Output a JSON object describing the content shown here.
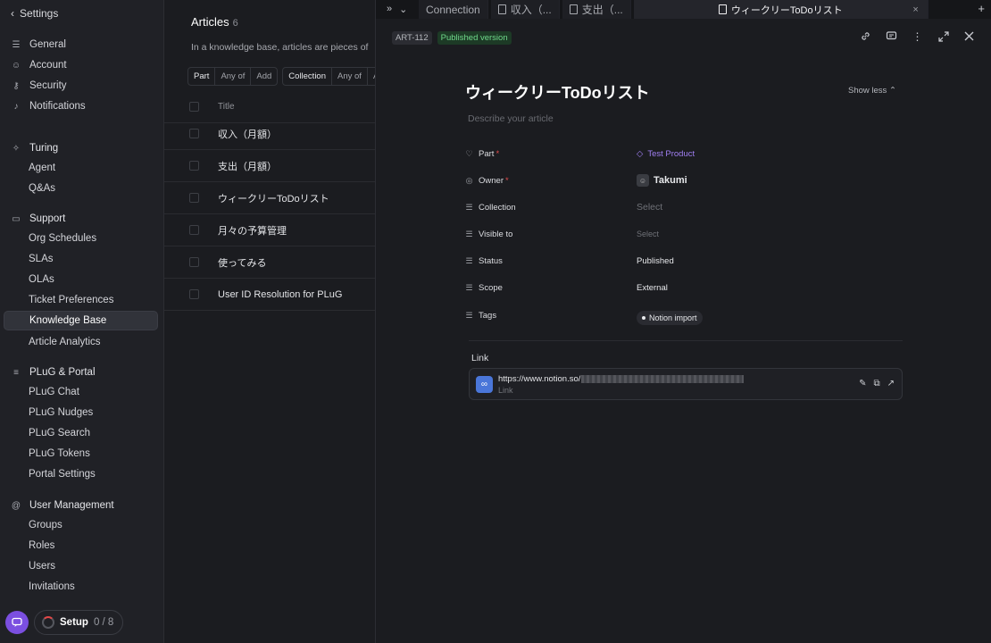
{
  "sidebar": {
    "back_label": "Settings",
    "items": [
      {
        "label": "General",
        "icon": "sliders-icon"
      },
      {
        "label": "Account",
        "icon": "user-icon"
      },
      {
        "label": "Security",
        "icon": "key-icon"
      },
      {
        "label": "Notifications",
        "icon": "bell-icon"
      }
    ],
    "groups": [
      {
        "label": "Turing",
        "icon": "sparkle-icon",
        "items": [
          "Agent",
          "Q&As"
        ]
      },
      {
        "label": "Support",
        "icon": "chat-icon",
        "items": [
          "Org Schedules",
          "SLAs",
          "OLAs",
          "Ticket Preferences",
          "Knowledge Base",
          "Article Analytics"
        ]
      },
      {
        "label": "PLuG & Portal",
        "icon": "stack-icon",
        "items": [
          "PLuG Chat",
          "PLuG Nudges",
          "PLuG Search",
          "PLuG Tokens",
          "Portal Settings"
        ]
      },
      {
        "label": "User Management",
        "icon": "at-icon",
        "items": [
          "Groups",
          "Roles",
          "Users",
          "Invitations"
        ]
      }
    ],
    "active_item": "Knowledge Base",
    "setup": {
      "label": "Setup",
      "count": "0 / 8"
    }
  },
  "list": {
    "title": "Articles",
    "count": "6",
    "description": "In a knowledge base, articles are pieces of",
    "filters": [
      {
        "field": "Part",
        "op": "Any of",
        "action": "Add"
      },
      {
        "field": "Collection",
        "op": "Any of",
        "action": "Ad"
      }
    ],
    "column_title": "Title",
    "rows": [
      "収入（月額）",
      "支出（月額）",
      "ウィークリーToDoリスト",
      "月々の予算管理",
      "使ってみる",
      "User ID Resolution for PLuG"
    ]
  },
  "tabs": {
    "items": [
      "Connection",
      "収入（...",
      "支出（..."
    ],
    "active": "ウィークリーToDoリスト"
  },
  "article": {
    "id": "ART-112",
    "status_badge": "Published version",
    "title": "ウィークリーToDoリスト",
    "show_less": "Show less",
    "description_placeholder": "Describe your article",
    "props": {
      "part": {
        "label": "Part",
        "value": "Test Product"
      },
      "owner": {
        "label": "Owner",
        "value": "Takumi"
      },
      "collection": {
        "label": "Collection",
        "value": "Select"
      },
      "visible_to": {
        "label": "Visible to",
        "value": "Select"
      },
      "status": {
        "label": "Status",
        "value": "Published"
      },
      "scope": {
        "label": "Scope",
        "value": "External"
      },
      "tags": {
        "label": "Tags",
        "value": "Notion import"
      }
    },
    "link": {
      "heading": "Link",
      "url": "https://www.notion.so/",
      "sub": "Link"
    }
  },
  "colors": {
    "accent": "#7b4fe0",
    "published": "#6fd88a",
    "part_link": "#a07ff2",
    "required": "#e24b4b"
  }
}
